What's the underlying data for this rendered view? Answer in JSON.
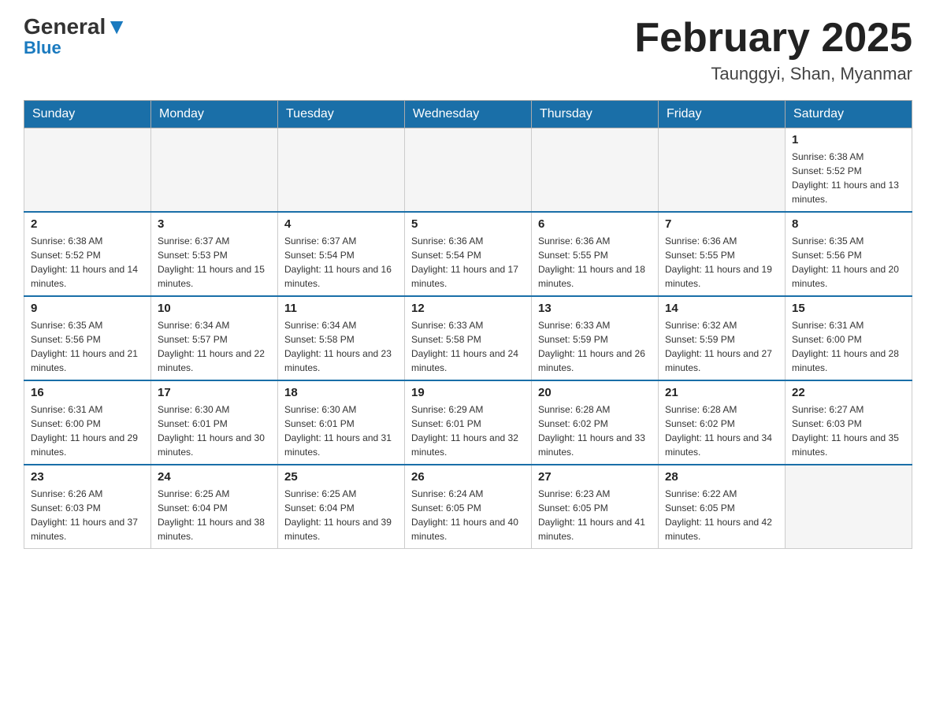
{
  "header": {
    "logo_general": "General",
    "logo_blue": "Blue",
    "month_title": "February 2025",
    "location": "Taunggyi, Shan, Myanmar"
  },
  "days_of_week": [
    "Sunday",
    "Monday",
    "Tuesday",
    "Wednesday",
    "Thursday",
    "Friday",
    "Saturday"
  ],
  "weeks": [
    [
      {
        "day": "",
        "info": ""
      },
      {
        "day": "",
        "info": ""
      },
      {
        "day": "",
        "info": ""
      },
      {
        "day": "",
        "info": ""
      },
      {
        "day": "",
        "info": ""
      },
      {
        "day": "",
        "info": ""
      },
      {
        "day": "1",
        "info": "Sunrise: 6:38 AM\nSunset: 5:52 PM\nDaylight: 11 hours and 13 minutes."
      }
    ],
    [
      {
        "day": "2",
        "info": "Sunrise: 6:38 AM\nSunset: 5:52 PM\nDaylight: 11 hours and 14 minutes."
      },
      {
        "day": "3",
        "info": "Sunrise: 6:37 AM\nSunset: 5:53 PM\nDaylight: 11 hours and 15 minutes."
      },
      {
        "day": "4",
        "info": "Sunrise: 6:37 AM\nSunset: 5:54 PM\nDaylight: 11 hours and 16 minutes."
      },
      {
        "day": "5",
        "info": "Sunrise: 6:36 AM\nSunset: 5:54 PM\nDaylight: 11 hours and 17 minutes."
      },
      {
        "day": "6",
        "info": "Sunrise: 6:36 AM\nSunset: 5:55 PM\nDaylight: 11 hours and 18 minutes."
      },
      {
        "day": "7",
        "info": "Sunrise: 6:36 AM\nSunset: 5:55 PM\nDaylight: 11 hours and 19 minutes."
      },
      {
        "day": "8",
        "info": "Sunrise: 6:35 AM\nSunset: 5:56 PM\nDaylight: 11 hours and 20 minutes."
      }
    ],
    [
      {
        "day": "9",
        "info": "Sunrise: 6:35 AM\nSunset: 5:56 PM\nDaylight: 11 hours and 21 minutes."
      },
      {
        "day": "10",
        "info": "Sunrise: 6:34 AM\nSunset: 5:57 PM\nDaylight: 11 hours and 22 minutes."
      },
      {
        "day": "11",
        "info": "Sunrise: 6:34 AM\nSunset: 5:58 PM\nDaylight: 11 hours and 23 minutes."
      },
      {
        "day": "12",
        "info": "Sunrise: 6:33 AM\nSunset: 5:58 PM\nDaylight: 11 hours and 24 minutes."
      },
      {
        "day": "13",
        "info": "Sunrise: 6:33 AM\nSunset: 5:59 PM\nDaylight: 11 hours and 26 minutes."
      },
      {
        "day": "14",
        "info": "Sunrise: 6:32 AM\nSunset: 5:59 PM\nDaylight: 11 hours and 27 minutes."
      },
      {
        "day": "15",
        "info": "Sunrise: 6:31 AM\nSunset: 6:00 PM\nDaylight: 11 hours and 28 minutes."
      }
    ],
    [
      {
        "day": "16",
        "info": "Sunrise: 6:31 AM\nSunset: 6:00 PM\nDaylight: 11 hours and 29 minutes."
      },
      {
        "day": "17",
        "info": "Sunrise: 6:30 AM\nSunset: 6:01 PM\nDaylight: 11 hours and 30 minutes."
      },
      {
        "day": "18",
        "info": "Sunrise: 6:30 AM\nSunset: 6:01 PM\nDaylight: 11 hours and 31 minutes."
      },
      {
        "day": "19",
        "info": "Sunrise: 6:29 AM\nSunset: 6:01 PM\nDaylight: 11 hours and 32 minutes."
      },
      {
        "day": "20",
        "info": "Sunrise: 6:28 AM\nSunset: 6:02 PM\nDaylight: 11 hours and 33 minutes."
      },
      {
        "day": "21",
        "info": "Sunrise: 6:28 AM\nSunset: 6:02 PM\nDaylight: 11 hours and 34 minutes."
      },
      {
        "day": "22",
        "info": "Sunrise: 6:27 AM\nSunset: 6:03 PM\nDaylight: 11 hours and 35 minutes."
      }
    ],
    [
      {
        "day": "23",
        "info": "Sunrise: 6:26 AM\nSunset: 6:03 PM\nDaylight: 11 hours and 37 minutes."
      },
      {
        "day": "24",
        "info": "Sunrise: 6:25 AM\nSunset: 6:04 PM\nDaylight: 11 hours and 38 minutes."
      },
      {
        "day": "25",
        "info": "Sunrise: 6:25 AM\nSunset: 6:04 PM\nDaylight: 11 hours and 39 minutes."
      },
      {
        "day": "26",
        "info": "Sunrise: 6:24 AM\nSunset: 6:05 PM\nDaylight: 11 hours and 40 minutes."
      },
      {
        "day": "27",
        "info": "Sunrise: 6:23 AM\nSunset: 6:05 PM\nDaylight: 11 hours and 41 minutes."
      },
      {
        "day": "28",
        "info": "Sunrise: 6:22 AM\nSunset: 6:05 PM\nDaylight: 11 hours and 42 minutes."
      },
      {
        "day": "",
        "info": ""
      }
    ]
  ]
}
